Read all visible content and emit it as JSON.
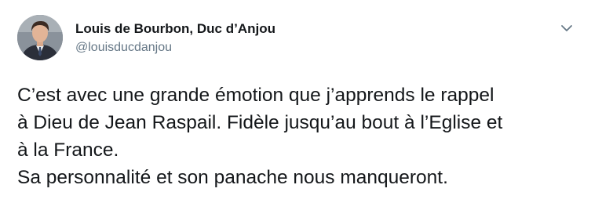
{
  "tweet": {
    "author": {
      "display_name": "Louis de Bourbon, Duc d’Anjou",
      "handle": "@louisducdanjou",
      "avatar_icon": "profile-photo"
    },
    "menu_icon": "chevron-down-icon",
    "text_lines": [
      "C’est avec une grande émotion que j’apprends le rappel",
      "à Dieu de Jean Raspail. Fidèle jusqu’au bout à l’Eglise et",
      "à la France.",
      "Sa personnalité et son panache nous manqueront."
    ]
  },
  "colors": {
    "text": "#14171a",
    "secondary_text": "#657786",
    "background": "#ffffff"
  }
}
